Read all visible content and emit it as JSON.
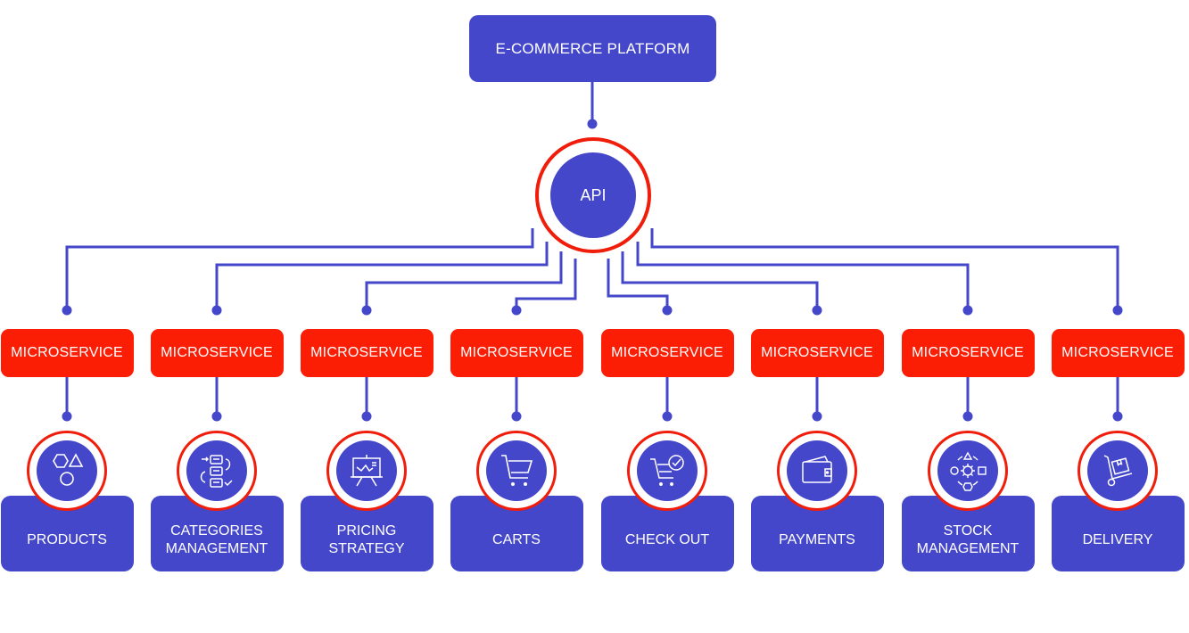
{
  "colors": {
    "primary": "#4547cb",
    "accent": "#fb1e05",
    "ring": "#f01d0b",
    "background": "#ffffff"
  },
  "platform": {
    "label": "E-COMMERCE PLATFORM"
  },
  "api": {
    "label": "API"
  },
  "services": [
    {
      "microservice_label": "MICROSERVICE",
      "name_lines": [
        "PRODUCTS"
      ],
      "icon": "shapes-icon"
    },
    {
      "microservice_label": "MICROSERVICE",
      "name_lines": [
        "CATEGORIES",
        "MANAGEMENT"
      ],
      "icon": "category-flow-icon"
    },
    {
      "microservice_label": "MICROSERVICE",
      "name_lines": [
        "PRICING",
        "STRATEGY"
      ],
      "icon": "presentation-chart-icon"
    },
    {
      "microservice_label": "MICROSERVICE",
      "name_lines": [
        "CARTS"
      ],
      "icon": "shopping-cart-icon"
    },
    {
      "microservice_label": "MICROSERVICE",
      "name_lines": [
        "CHECK OUT"
      ],
      "icon": "cart-check-icon"
    },
    {
      "microservice_label": "MICROSERVICE",
      "name_lines": [
        "PAYMENTS"
      ],
      "icon": "wallet-icon"
    },
    {
      "microservice_label": "MICROSERVICE",
      "name_lines": [
        "STOCK",
        "MANAGEMENT"
      ],
      "icon": "stock-gear-icon"
    },
    {
      "microservice_label": "MICROSERVICE",
      "name_lines": [
        "DELIVERY"
      ],
      "icon": "hand-truck-icon"
    }
  ]
}
